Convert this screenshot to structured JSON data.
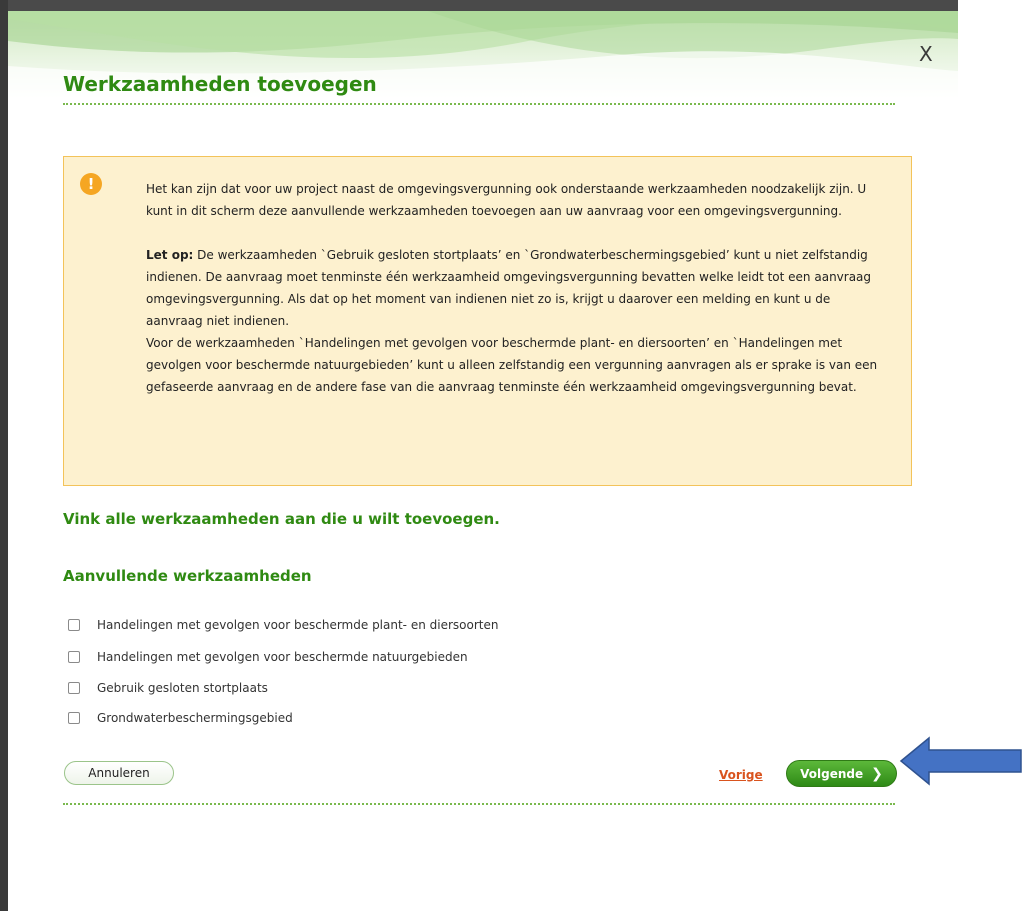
{
  "dialog": {
    "close_label": "X",
    "title": "Werkzaamheden toevoegen"
  },
  "warning": {
    "icon": "exclamation-icon",
    "paragraph1": "Het kan zijn dat voor uw project naast de omgevingsvergunning ook onderstaande werkzaamheden noodzakelijk zijn. U kunt in dit scherm deze aanvullende werkzaamheden toevoegen aan uw aanvraag voor een omgevingsvergunning.",
    "let_op_label": "Let op:",
    "paragraph2": " De werkzaamheden `Gebruik gesloten stortplaats’ en `Grondwaterbeschermingsgebied’ kunt u niet zelfstandig indienen. De aanvraag moet tenminste één werkzaamheid omgevingsvergunning bevatten welke leidt tot een aanvraag omgevingsvergunning. Als dat op het moment van indienen niet zo is, krijgt u daarover een melding en kunt u de aanvraag niet indienen.",
    "paragraph3": "Voor de werkzaamheden `Handelingen met gevolgen voor beschermde plant- en diersoorten’ en `Handelingen met gevolgen voor beschermde natuurgebieden’ kunt u alleen zelfstandig een vergunning aanvragen als er sprake is van een gefaseerde aanvraag en de andere fase van die aanvraag tenminste één werkzaamheid omgevingsvergunning bevat."
  },
  "instruction": "Vink alle werkzaamheden aan die u wilt toevoegen.",
  "section_title": "Aanvullende werkzaamheden",
  "options": [
    {
      "label": "Handelingen met gevolgen voor beschermde plant- en diersoorten",
      "checked": false
    },
    {
      "label": "Handelingen met gevolgen voor beschermde natuurgebieden",
      "checked": false
    },
    {
      "label": "Gebruik gesloten stortplaats",
      "checked": false
    },
    {
      "label": "Grondwaterbeschermingsgebied",
      "checked": false
    }
  ],
  "footer": {
    "cancel_label": "Annuleren",
    "prev_label": "Vorige",
    "next_label": "Volgende",
    "next_icon": "chevron-right-icon"
  },
  "annotation": {
    "icon": "blue-arrow-left-icon"
  },
  "colors": {
    "accent_green": "#2f8a12",
    "warning_bg": "#fdf1cf",
    "warning_border": "#f3c35a",
    "link_orange": "#d9531e",
    "arrow_blue": "#4472c4"
  }
}
